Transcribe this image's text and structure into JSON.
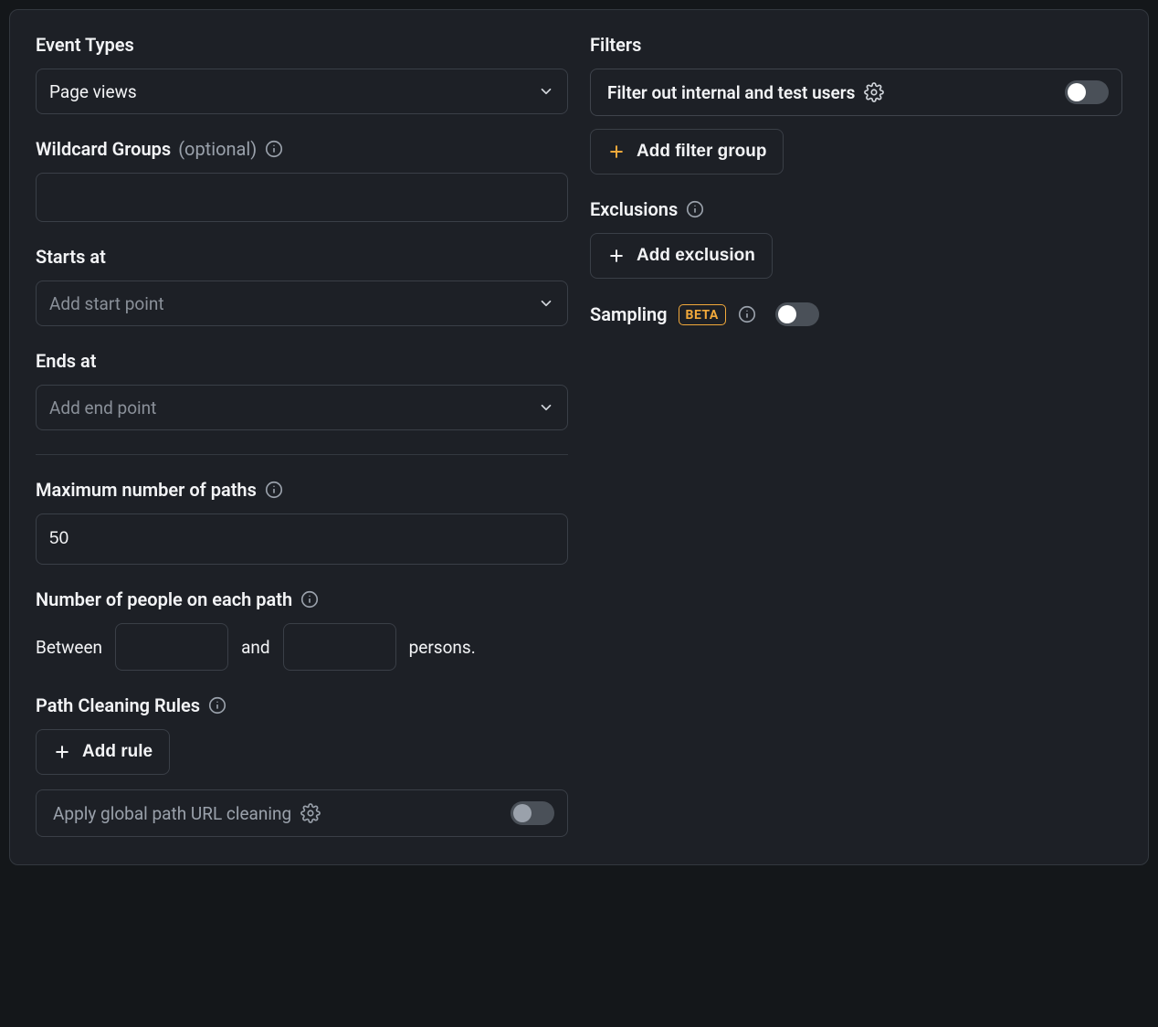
{
  "left": {
    "event_types": {
      "label": "Event Types",
      "value": "Page views"
    },
    "wildcard_groups": {
      "label": "Wildcard Groups",
      "suffix": "(optional)",
      "value": ""
    },
    "starts_at": {
      "label": "Starts at",
      "placeholder": "Add start point"
    },
    "ends_at": {
      "label": "Ends at",
      "placeholder": "Add end point"
    },
    "max_paths": {
      "label": "Maximum number of paths",
      "value": "50"
    },
    "people_per_path": {
      "label": "Number of people on each path",
      "between": "Between",
      "and": "and",
      "suffix": "persons."
    },
    "path_cleaning": {
      "label": "Path Cleaning Rules",
      "add_rule": "Add rule",
      "global_apply": "Apply global path URL cleaning"
    }
  },
  "right": {
    "filters": {
      "label": "Filters",
      "internal_test": "Filter out internal and test users",
      "add_group": "Add filter group"
    },
    "exclusions": {
      "label": "Exclusions",
      "add": "Add exclusion"
    },
    "sampling": {
      "label": "Sampling",
      "badge": "BETA"
    }
  },
  "toggles": {
    "filter_internal": false,
    "sampling": false,
    "global_clean": false
  }
}
